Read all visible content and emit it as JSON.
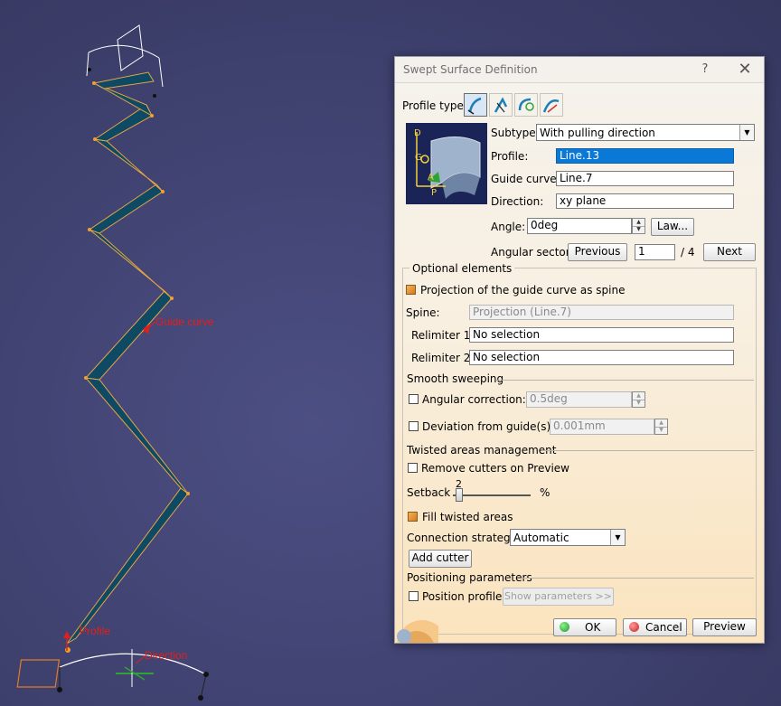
{
  "viewport": {
    "labels": {
      "profile": "Profile",
      "guide_curve": "Guide curve",
      "direction": "Direction"
    }
  },
  "dialog": {
    "title": "Swept Surface Definition",
    "help_glyph": "?",
    "close_glyph": "✕",
    "profile_type_label": "Profile type:",
    "profile_type_icons": [
      "explicit-profile-icon",
      "line-profile-icon",
      "circle-profile-icon",
      "conic-profile-icon"
    ],
    "preview_letters": {
      "d": "D",
      "g": "G",
      "a": "A",
      "p": "P"
    },
    "subtype_label": "Subtype:",
    "subtype_value": "With pulling direction",
    "profile_label": "Profile:",
    "profile_value": "Line.13",
    "guide_curve_label": "Guide curve:",
    "guide_curve_value": "Line.7",
    "direction_label": "Direction:",
    "direction_value": "xy plane",
    "angle_label": "Angle:",
    "angle_value": "0deg",
    "law_button": "Law...",
    "angular_sector_label": "Angular sector:",
    "previous_button": "Previous",
    "sector_value": "1",
    "sector_total": "/ 4",
    "next_button": "Next",
    "optional_elements": {
      "title": "Optional elements",
      "projection_label": "Projection of the guide curve as spine",
      "spine_label": "Spine:",
      "spine_value": "Projection (Line.7)",
      "relimiter1_label": "Relimiter 1:",
      "relimiter1_value": "No selection",
      "relimiter2_label": "Relimiter 2:",
      "relimiter2_value": "No selection"
    },
    "smooth_sweeping": {
      "title": "Smooth sweeping",
      "angular_correction_label": "Angular correction:",
      "angular_correction_value": "0.5deg",
      "deviation_label": "Deviation from guide(s):",
      "deviation_value": "0.001mm"
    },
    "twisted_areas": {
      "title": "Twisted areas management",
      "remove_cutters_label": "Remove cutters on Preview",
      "setback_label": "Setback",
      "setback_value": "2",
      "setback_fraction": 0.04,
      "setback_unit": "%",
      "fill_label": "Fill twisted areas",
      "connection_label": "Connection strategy:",
      "connection_value": "Automatic",
      "add_cutter_button": "Add cutter"
    },
    "positioning": {
      "title": "Positioning parameters",
      "position_profile_label": "Position profile",
      "show_parameters_button": "Show parameters >>"
    },
    "footer": {
      "ok_button": "OK",
      "cancel_button": "Cancel",
      "preview_button": "Preview"
    },
    "colors": {
      "accent_orange": "#d57a17",
      "selection_blue": "#0a78d7",
      "ok_green": "#1d9a2a",
      "cancel_red": "#c8231d",
      "surface_teal": "#0e4a63"
    }
  }
}
